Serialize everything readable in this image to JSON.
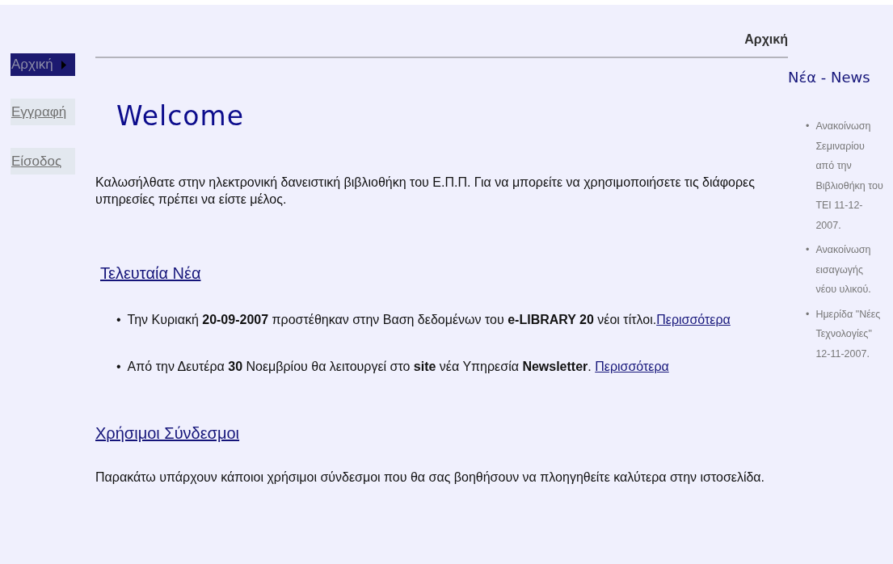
{
  "sidebar": {
    "items": [
      {
        "label": "Αρχική",
        "selected": true
      },
      {
        "label": "Εγγραφή",
        "selected": false
      },
      {
        "label": "Είσοδος",
        "selected": false
      }
    ]
  },
  "breadcrumb": "Αρχική",
  "main": {
    "title": "Welcome",
    "intro": "Καλωσήλθατε στην ηλεκτρονική δανειστική βιβλιοθήκη του Ε.Π.Π. Για να μπορείτε να χρησιμοποιήσετε τις διάφορες υπηρεσίες πρέπει να είστε μέλος.",
    "latest_news": {
      "heading": "Τελευταία Νέα",
      "items": [
        {
          "bullet": "•",
          "text": "Την Κυριακή **20-09-2007** προστέθηκαν στην Βαση δεδομένων του **e-LIBRARY 20** νέοι τίτλοι.",
          "link": "Περισσότερα"
        },
        {
          "bullet": "•",
          "text": "Από την Δευτέρα **30** Νοεμβρίου θα λειτουργεί στο **site** νέα Υπηρεσία **Newsletter**. ",
          "link": "Περισσότερα"
        }
      ]
    },
    "useful_links": {
      "heading": "Χρήσιμοι Σύνδεσμοι",
      "text": "Παρακάτω υπάρχουν κάποιοι χρήσιμοι σύνδεσμοι που θα σας βοηθήσουν να πλοηγηθείτε καλύτερα στην ιστοσελίδα."
    }
  },
  "news_panel": {
    "heading": "Νέα - News",
    "items": [
      {
        "bullet": "•",
        "text": "Ανακοίνωση Σεμιναρίου από την Βιβλιοθήκη του ΤΕΙ 11-12-2007."
      },
      {
        "bullet": "•",
        "text": "Ανακοίνωση εισαγωγής νέου υλικού."
      },
      {
        "bullet": "•",
        "text": "Ημερίδα \"Νέες Τεχνολογίες\" 12-11-2007."
      }
    ]
  }
}
